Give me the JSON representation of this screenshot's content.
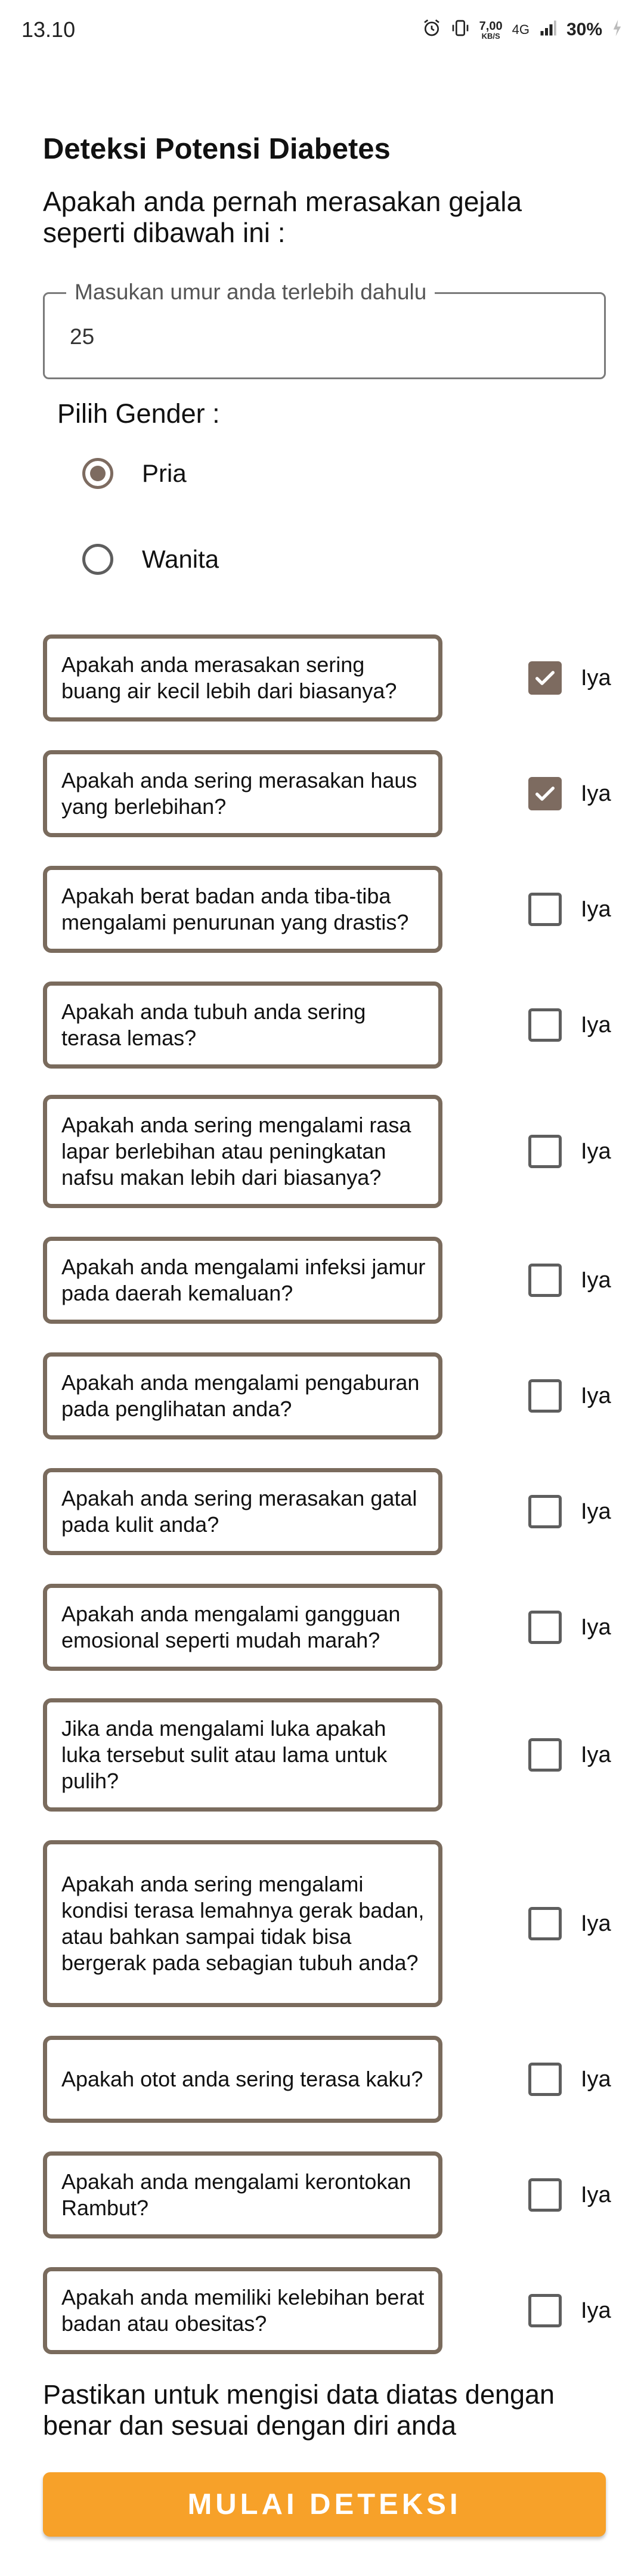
{
  "status_bar": {
    "time": "13.10",
    "net_speed": "7,00",
    "net_unit": "KB/S",
    "network": "4G",
    "battery": "30%"
  },
  "header": {
    "title": "Deteksi Potensi Diabetes",
    "subtitle": "Apakah anda pernah merasakan gejala seperti dibawah ini :"
  },
  "age_field": {
    "label": "Masukan umur anda terlebih dahulu",
    "value": "25"
  },
  "gender": {
    "title": "Pilih Gender :",
    "options": [
      {
        "label": "Pria",
        "selected": true
      },
      {
        "label": "Wanita",
        "selected": false
      }
    ]
  },
  "questions": [
    {
      "text": "Apakah anda merasakan sering buang air kecil lebih dari biasanya?",
      "answer_label": "Iya",
      "checked": true
    },
    {
      "text": "Apakah anda sering merasakan haus yang berlebihan?",
      "answer_label": "Iya",
      "checked": true
    },
    {
      "text": "Apakah berat badan anda tiba-tiba mengalami penurunan yang drastis?",
      "answer_label": "Iya",
      "checked": false
    },
    {
      "text": "Apakah anda tubuh anda sering terasa lemas?",
      "answer_label": "Iya",
      "checked": false
    },
    {
      "text": "Apakah anda sering mengalami rasa lapar berlebihan atau peningkatan nafsu makan lebih dari biasanya?",
      "answer_label": "Iya",
      "checked": false
    },
    {
      "text": "Apakah anda mengalami infeksi jamur pada daerah kemaluan?",
      "answer_label": "Iya",
      "checked": false
    },
    {
      "text": "Apakah anda mengalami pengaburan pada penglihatan anda?",
      "answer_label": "Iya",
      "checked": false
    },
    {
      "text": "Apakah anda sering merasakan gatal pada kulit anda?",
      "answer_label": "Iya",
      "checked": false
    },
    {
      "text": "Apakah anda mengalami gangguan emosional seperti mudah marah?",
      "answer_label": "Iya",
      "checked": false
    },
    {
      "text": "Jika anda mengalami luka apakah luka tersebut sulit atau lama untuk pulih?",
      "answer_label": "Iya",
      "checked": false
    },
    {
      "text": "Apakah anda sering mengalami kondisi terasa lemahnya gerak badan, atau bahkan sampai tidak bisa bergerak pada sebagian tubuh anda?",
      "answer_label": "Iya",
      "checked": false
    },
    {
      "text": "Apakah otot anda sering terasa kaku?",
      "answer_label": "Iya",
      "checked": false
    },
    {
      "text": "Apakah anda mengalami kerontokan Rambut?",
      "answer_label": "Iya",
      "checked": false
    },
    {
      "text": "Apakah anda memiliki kelebihan berat badan atau obesitas?",
      "answer_label": "Iya",
      "checked": false
    }
  ],
  "footer": {
    "note": "Pastikan untuk mengisi data diatas dengan benar dan sesuai dengan diri anda",
    "button_label": "MULAI DETEKSI"
  },
  "colors": {
    "accent": "#7d6b60",
    "card_border": "#7a6b5d",
    "button": "#f7a129"
  }
}
